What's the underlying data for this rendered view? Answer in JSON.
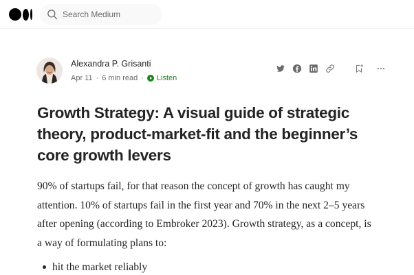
{
  "header": {
    "logo_icon": "medium-logo-icon",
    "search": {
      "placeholder": "Search Medium",
      "icon": "search-icon"
    }
  },
  "author": {
    "name": "Alexandra P. Grisanti",
    "date": "Apr 11",
    "separator": "·",
    "read_time": "6 min read",
    "listen_label": "Listen",
    "avatar_icon": "author-avatar"
  },
  "share_actions": [
    {
      "icon": "twitter-icon"
    },
    {
      "icon": "facebook-icon"
    },
    {
      "icon": "linkedin-icon"
    },
    {
      "icon": "link-icon"
    }
  ],
  "actions": {
    "save_icon": "bookmark-add-icon",
    "more_icon": "more-icon"
  },
  "colors": {
    "accent_green": "#1a8917",
    "text": "#242424",
    "muted": "#6b6b6b"
  },
  "article": {
    "title_lines": [
      "Growth Strategy: A visual guide of strategic",
      "theory, product-market-fit and the beginner’s",
      "core growth levers"
    ],
    "paragraph_lines": [
      "90% of startups fail, for that reason the concept of growth has caught my",
      "attention. 10% of startups fail in the first year and 70% in the next 2–5 years",
      "after opening (according to Embroker 2023). Growth strategy, as a concept, is",
      "a way of formulating plans to:"
    ],
    "bullets": [
      "hit the market reliably"
    ]
  }
}
